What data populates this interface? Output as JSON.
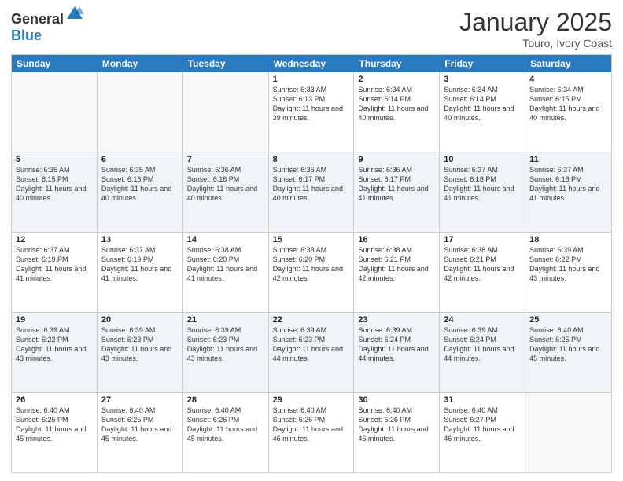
{
  "header": {
    "logo_general": "General",
    "logo_blue": "Blue",
    "title": "January 2025",
    "location": "Touro, Ivory Coast"
  },
  "days_of_week": [
    "Sunday",
    "Monday",
    "Tuesday",
    "Wednesday",
    "Thursday",
    "Friday",
    "Saturday"
  ],
  "weeks": [
    [
      {
        "day": "",
        "sunrise": "",
        "sunset": "",
        "daylight": ""
      },
      {
        "day": "",
        "sunrise": "",
        "sunset": "",
        "daylight": ""
      },
      {
        "day": "",
        "sunrise": "",
        "sunset": "",
        "daylight": ""
      },
      {
        "day": "1",
        "sunrise": "Sunrise: 6:33 AM",
        "sunset": "Sunset: 6:13 PM",
        "daylight": "Daylight: 11 hours and 39 minutes."
      },
      {
        "day": "2",
        "sunrise": "Sunrise: 6:34 AM",
        "sunset": "Sunset: 6:14 PM",
        "daylight": "Daylight: 11 hours and 40 minutes."
      },
      {
        "day": "3",
        "sunrise": "Sunrise: 6:34 AM",
        "sunset": "Sunset: 6:14 PM",
        "daylight": "Daylight: 11 hours and 40 minutes."
      },
      {
        "day": "4",
        "sunrise": "Sunrise: 6:34 AM",
        "sunset": "Sunset: 6:15 PM",
        "daylight": "Daylight: 11 hours and 40 minutes."
      }
    ],
    [
      {
        "day": "5",
        "sunrise": "Sunrise: 6:35 AM",
        "sunset": "Sunset: 6:15 PM",
        "daylight": "Daylight: 11 hours and 40 minutes."
      },
      {
        "day": "6",
        "sunrise": "Sunrise: 6:35 AM",
        "sunset": "Sunset: 6:16 PM",
        "daylight": "Daylight: 11 hours and 40 minutes."
      },
      {
        "day": "7",
        "sunrise": "Sunrise: 6:36 AM",
        "sunset": "Sunset: 6:16 PM",
        "daylight": "Daylight: 11 hours and 40 minutes."
      },
      {
        "day": "8",
        "sunrise": "Sunrise: 6:36 AM",
        "sunset": "Sunset: 6:17 PM",
        "daylight": "Daylight: 11 hours and 40 minutes."
      },
      {
        "day": "9",
        "sunrise": "Sunrise: 6:36 AM",
        "sunset": "Sunset: 6:17 PM",
        "daylight": "Daylight: 11 hours and 41 minutes."
      },
      {
        "day": "10",
        "sunrise": "Sunrise: 6:37 AM",
        "sunset": "Sunset: 6:18 PM",
        "daylight": "Daylight: 11 hours and 41 minutes."
      },
      {
        "day": "11",
        "sunrise": "Sunrise: 6:37 AM",
        "sunset": "Sunset: 6:18 PM",
        "daylight": "Daylight: 11 hours and 41 minutes."
      }
    ],
    [
      {
        "day": "12",
        "sunrise": "Sunrise: 6:37 AM",
        "sunset": "Sunset: 6:19 PM",
        "daylight": "Daylight: 11 hours and 41 minutes."
      },
      {
        "day": "13",
        "sunrise": "Sunrise: 6:37 AM",
        "sunset": "Sunset: 6:19 PM",
        "daylight": "Daylight: 11 hours and 41 minutes."
      },
      {
        "day": "14",
        "sunrise": "Sunrise: 6:38 AM",
        "sunset": "Sunset: 6:20 PM",
        "daylight": "Daylight: 11 hours and 41 minutes."
      },
      {
        "day": "15",
        "sunrise": "Sunrise: 6:38 AM",
        "sunset": "Sunset: 6:20 PM",
        "daylight": "Daylight: 11 hours and 42 minutes."
      },
      {
        "day": "16",
        "sunrise": "Sunrise: 6:38 AM",
        "sunset": "Sunset: 6:21 PM",
        "daylight": "Daylight: 11 hours and 42 minutes."
      },
      {
        "day": "17",
        "sunrise": "Sunrise: 6:38 AM",
        "sunset": "Sunset: 6:21 PM",
        "daylight": "Daylight: 11 hours and 42 minutes."
      },
      {
        "day": "18",
        "sunrise": "Sunrise: 6:39 AM",
        "sunset": "Sunset: 6:22 PM",
        "daylight": "Daylight: 11 hours and 43 minutes."
      }
    ],
    [
      {
        "day": "19",
        "sunrise": "Sunrise: 6:39 AM",
        "sunset": "Sunset: 6:22 PM",
        "daylight": "Daylight: 11 hours and 43 minutes."
      },
      {
        "day": "20",
        "sunrise": "Sunrise: 6:39 AM",
        "sunset": "Sunset: 6:23 PM",
        "daylight": "Daylight: 11 hours and 43 minutes."
      },
      {
        "day": "21",
        "sunrise": "Sunrise: 6:39 AM",
        "sunset": "Sunset: 6:23 PM",
        "daylight": "Daylight: 11 hours and 43 minutes."
      },
      {
        "day": "22",
        "sunrise": "Sunrise: 6:39 AM",
        "sunset": "Sunset: 6:23 PM",
        "daylight": "Daylight: 11 hours and 44 minutes."
      },
      {
        "day": "23",
        "sunrise": "Sunrise: 6:39 AM",
        "sunset": "Sunset: 6:24 PM",
        "daylight": "Daylight: 11 hours and 44 minutes."
      },
      {
        "day": "24",
        "sunrise": "Sunrise: 6:39 AM",
        "sunset": "Sunset: 6:24 PM",
        "daylight": "Daylight: 11 hours and 44 minutes."
      },
      {
        "day": "25",
        "sunrise": "Sunrise: 6:40 AM",
        "sunset": "Sunset: 6:25 PM",
        "daylight": "Daylight: 11 hours and 45 minutes."
      }
    ],
    [
      {
        "day": "26",
        "sunrise": "Sunrise: 6:40 AM",
        "sunset": "Sunset: 6:25 PM",
        "daylight": "Daylight: 11 hours and 45 minutes."
      },
      {
        "day": "27",
        "sunrise": "Sunrise: 6:40 AM",
        "sunset": "Sunset: 6:25 PM",
        "daylight": "Daylight: 11 hours and 45 minutes."
      },
      {
        "day": "28",
        "sunrise": "Sunrise: 6:40 AM",
        "sunset": "Sunset: 6:26 PM",
        "daylight": "Daylight: 11 hours and 45 minutes."
      },
      {
        "day": "29",
        "sunrise": "Sunrise: 6:40 AM",
        "sunset": "Sunset: 6:26 PM",
        "daylight": "Daylight: 11 hours and 46 minutes."
      },
      {
        "day": "30",
        "sunrise": "Sunrise: 6:40 AM",
        "sunset": "Sunset: 6:26 PM",
        "daylight": "Daylight: 11 hours and 46 minutes."
      },
      {
        "day": "31",
        "sunrise": "Sunrise: 6:40 AM",
        "sunset": "Sunset: 6:27 PM",
        "daylight": "Daylight: 11 hours and 46 minutes."
      },
      {
        "day": "",
        "sunrise": "",
        "sunset": "",
        "daylight": ""
      }
    ]
  ]
}
